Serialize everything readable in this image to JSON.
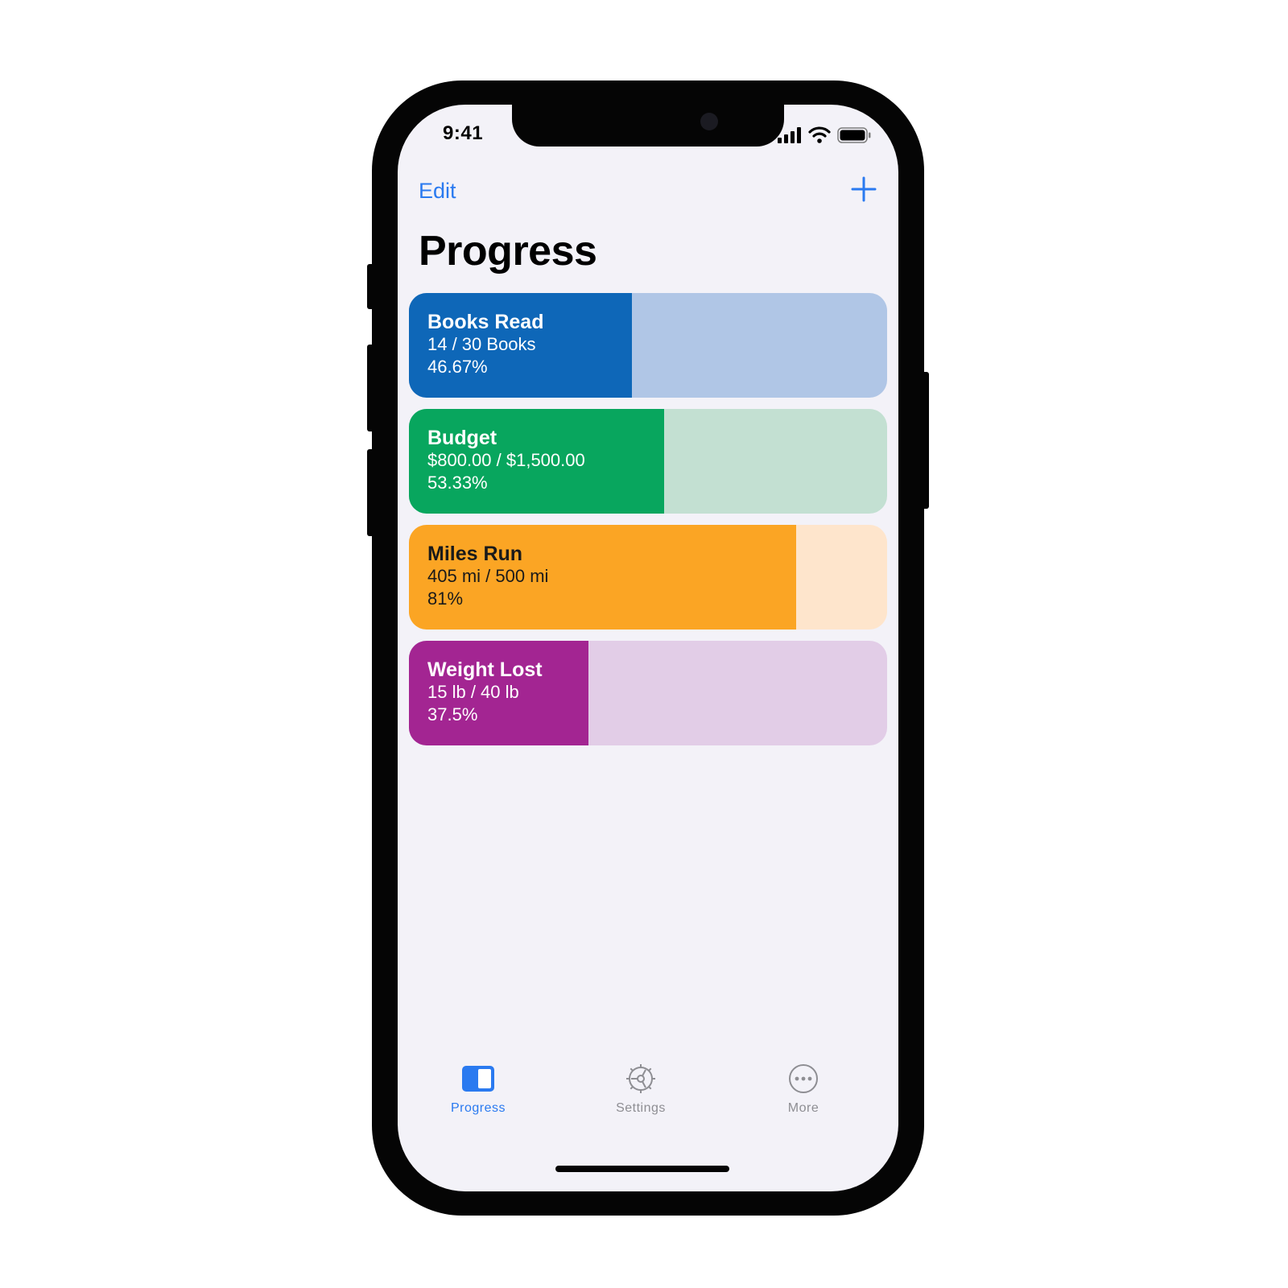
{
  "status_bar": {
    "time": "9:41"
  },
  "nav": {
    "edit_label": "Edit",
    "add_icon": "plus-icon"
  },
  "page": {
    "title": "Progress"
  },
  "colors": {
    "accent": "#2a7af0",
    "background": "#f3f2f8",
    "tab_inactive": "#8e8e93"
  },
  "progress_items": [
    {
      "title": "Books Read",
      "detail": "14 / 30 Books",
      "percent": "46.67%",
      "fraction": 0.4667,
      "fill_color": "#0e67b8",
      "track_color": "#b0c6e6",
      "text_color": "#ffffff"
    },
    {
      "title": "Budget",
      "detail": "$800.00 / $1,500.00",
      "percent": "53.33%",
      "fraction": 0.5333,
      "fill_color": "#08a65e",
      "track_color": "#c3e0d2",
      "text_color": "#ffffff"
    },
    {
      "title": "Miles Run",
      "detail": "405 mi / 500 mi",
      "percent": "81%",
      "fraction": 0.81,
      "fill_color": "#fba524",
      "track_color": "#fee5cc",
      "text_color": "#1a1a1a"
    },
    {
      "title": "Weight Lost",
      "detail": "15 lb / 40 lb",
      "percent": "37.5%",
      "fraction": 0.375,
      "fill_color": "#a32592",
      "track_color": "#e2cde7",
      "text_color": "#ffffff"
    }
  ],
  "tabs": [
    {
      "label": "Progress",
      "icon": "progress-icon",
      "selected": true
    },
    {
      "label": "Settings",
      "icon": "gear-icon",
      "selected": false
    },
    {
      "label": "More",
      "icon": "ellipsis-circle-icon",
      "selected": false
    }
  ]
}
